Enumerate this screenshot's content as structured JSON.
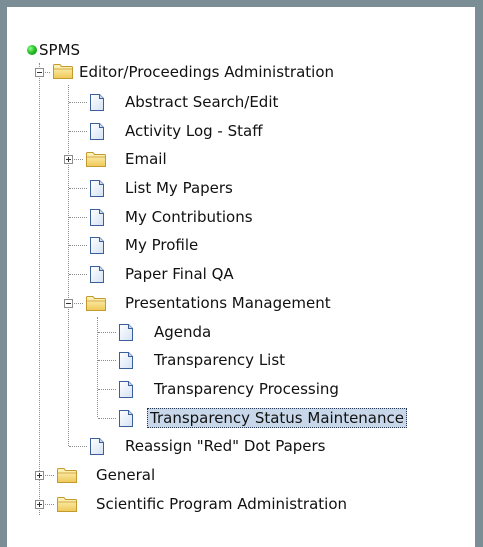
{
  "tree": {
    "root_label": "SPMS",
    "editor": {
      "label": "Editor/Proceedings Administration",
      "items": {
        "abstract_search": "Abstract Search/Edit",
        "activity_log": "Activity Log - Staff",
        "email": "Email",
        "list_my_papers": "List My Papers",
        "my_contributions": "My Contributions",
        "my_profile": "My Profile",
        "paper_final_qa": "Paper Final QA",
        "presentations": {
          "label": "Presentations Management",
          "items": {
            "agenda": "Agenda",
            "transparency_list": "Transparency List",
            "transparency_processing": "Transparency Processing",
            "transparency_status": "Transparency Status Maintenance"
          }
        },
        "reassign": "Reassign \"Red\" Dot Papers"
      }
    },
    "general": "General",
    "scientific": "Scientific Program Administration"
  },
  "colors": {
    "frame": "#7b8e95",
    "selection": "#c8d8ea",
    "status_dot": "#2bc22b",
    "folder": "#f0d060"
  },
  "icons": {
    "root": "green-dot-icon",
    "folder": "folder-icon",
    "page": "document-icon",
    "expand": "plus-box-icon",
    "collapse": "minus-box-icon"
  },
  "selected_item": "Transparency Status Maintenance"
}
